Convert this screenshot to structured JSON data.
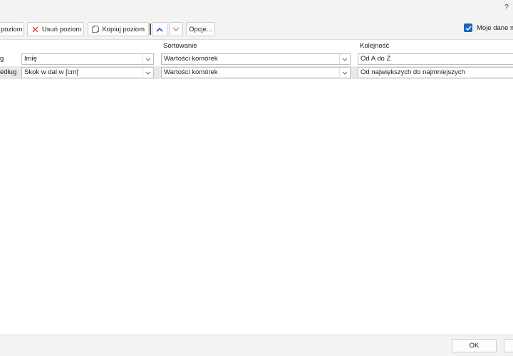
{
  "titlebar": {
    "help": "?"
  },
  "toolbar": {
    "add_level": "poziom",
    "delete_level": "Usuń poziom",
    "copy_level": "Kopiuj poziom",
    "options": "Opcje...",
    "headers_checkbox": "Moje dane m",
    "headers_checked": true
  },
  "columns": {
    "sort_on": "Sortowanie",
    "order": "Kolejność"
  },
  "rows": [
    {
      "label": "g",
      "column": "Imię",
      "sort_on": "Wartości komórek",
      "order": "Od A do Z"
    },
    {
      "label": "edług",
      "column": "Skok w dal w [cm]",
      "sort_on": "Wartości komórek",
      "order": "Od największych do najmniejszych"
    }
  ],
  "footer": {
    "ok": "OK"
  },
  "colors": {
    "accent": "#1565c0",
    "delete": "#d13438",
    "selected_row": "#e8e8e8"
  }
}
